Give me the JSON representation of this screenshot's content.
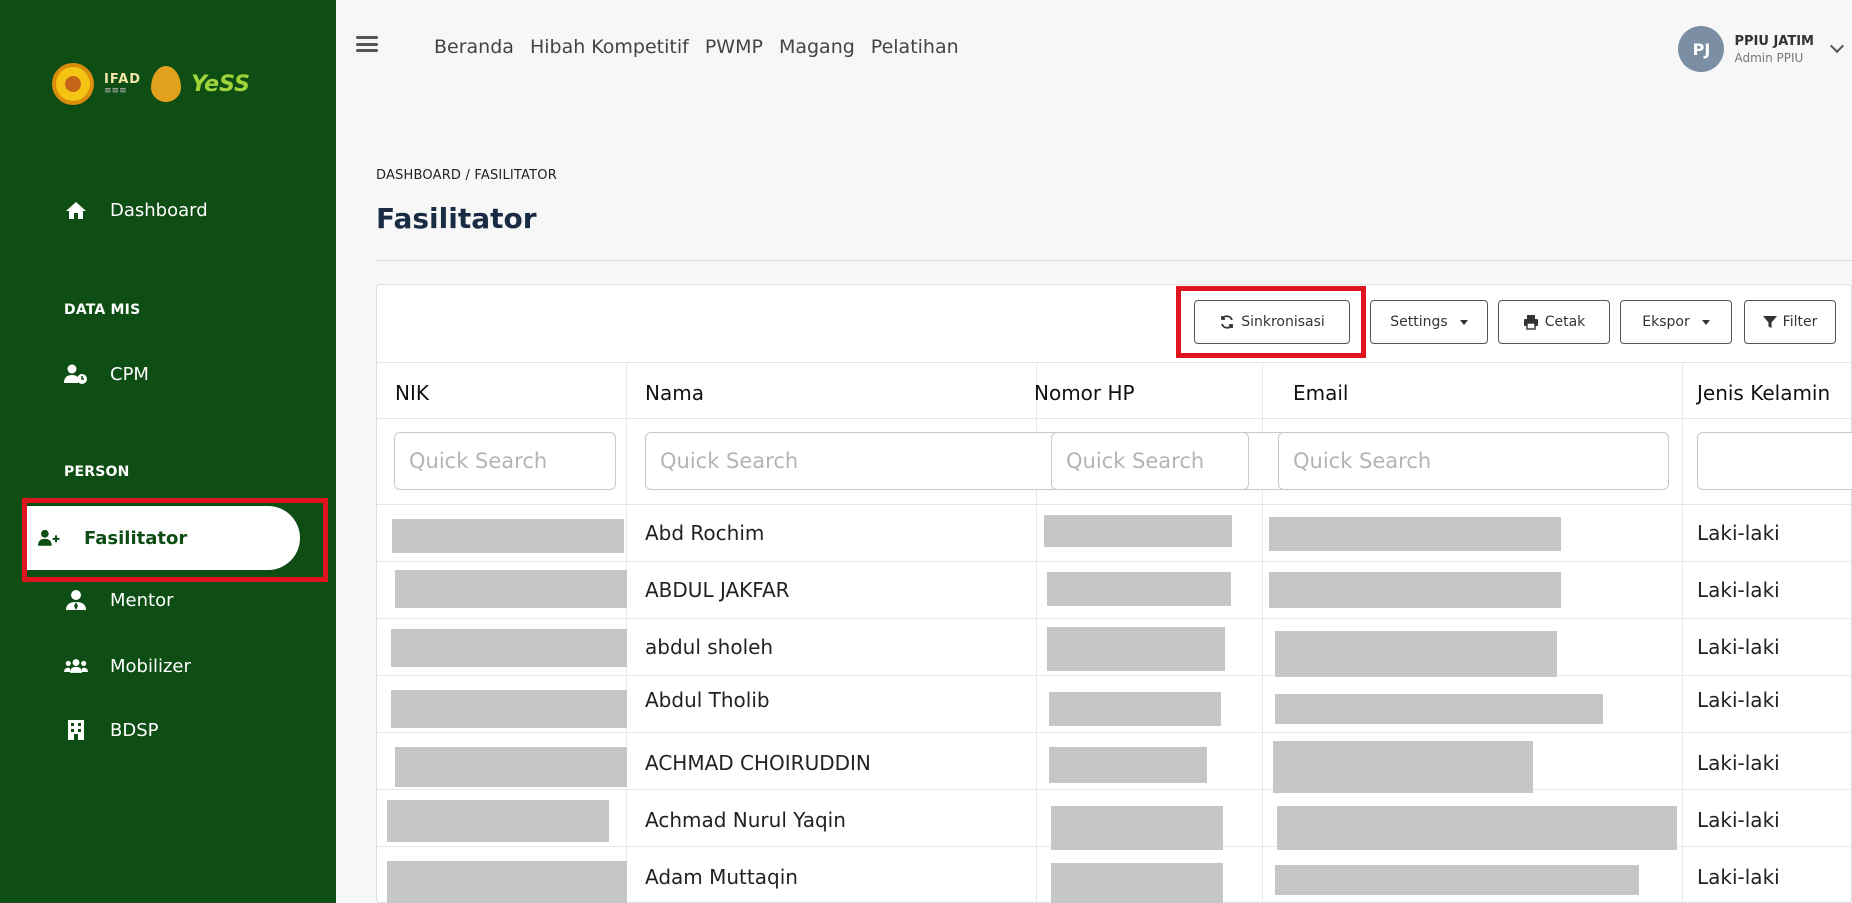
{
  "sidebar": {
    "logo": {
      "text1": "IFAD",
      "yess": "YeSS"
    },
    "items": [
      {
        "label": "Dashboard",
        "icon": "home-icon"
      },
      {
        "section": "DATA MIS"
      },
      {
        "label": "CPM",
        "icon": "user-clock-icon"
      },
      {
        "section": "PERSON"
      },
      {
        "label": "Fasilitator",
        "icon": "user-plus-icon",
        "active": true
      },
      {
        "label": "Mentor",
        "icon": "user-tie-icon"
      },
      {
        "label": "Mobilizer",
        "icon": "users-icon"
      },
      {
        "label": "BDSP",
        "icon": "building-icon"
      }
    ]
  },
  "topbar": {
    "menu": [
      "Beranda",
      "Hibah Kompetitif",
      "PWMP",
      "Magang",
      "Pelatihan"
    ],
    "user": {
      "initials": "PJ",
      "name": "PPIU JATIM",
      "role": "Admin PPIU"
    }
  },
  "header": {
    "breadcrumb": "DASHBOARD / FASILITATOR",
    "title": "Fasilitator"
  },
  "toolbar": {
    "sync": "Sinkronisasi",
    "settings": "Settings",
    "print": "Cetak",
    "export": "Ekspor",
    "filter": "Filter"
  },
  "table": {
    "columns": [
      "NIK",
      "Nama",
      "Nomor HP",
      "Email",
      "Jenis Kelamin"
    ],
    "search_placeholder": "Quick Search",
    "rows": [
      {
        "nama": "Abd Rochim",
        "jenis_kelamin": "Laki-laki"
      },
      {
        "nama": "ABDUL JAKFAR",
        "jenis_kelamin": "Laki-laki"
      },
      {
        "nama": "abdul sholeh",
        "jenis_kelamin": "Laki-laki"
      },
      {
        "nama": "Abdul Tholib",
        "jenis_kelamin": "Laki-laki"
      },
      {
        "nama": "ACHMAD CHOIRUDDIN",
        "jenis_kelamin": "Laki-laki"
      },
      {
        "nama": "Achmad Nurul Yaqin",
        "jenis_kelamin": "Laki-laki"
      },
      {
        "nama": "Adam Muttaqin",
        "jenis_kelamin": "Laki-laki"
      }
    ]
  },
  "colors": {
    "sidebar": "#0e4d14",
    "highlight": "#e0141e",
    "redaction": "#c6c6c6"
  }
}
